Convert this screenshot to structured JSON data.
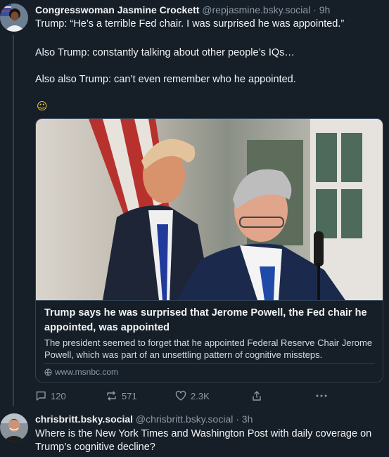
{
  "post1": {
    "author_name": "Congresswoman Jasmine Crockett",
    "author_handle": "@repjasmine.bsky.social",
    "separator": "·",
    "time": "9h",
    "paragraphs": [
      "Trump: “He’s a terrible Fed chair. I was surprised he was appointed.”",
      "Also Trump: constantly talking about other people’s IQs…",
      "Also also Trump: can’t even remember who he appointed."
    ],
    "emoji": "☺",
    "card": {
      "title": "Trump says he was surprised that Jerome Powell, the Fed chair he appointed, was appointed",
      "description": "The president seemed to forget that he appointed Federal Reserve Chair Jerome Powell, which was part of an unsettling pattern of cognitive missteps.",
      "domain": "www.msnbc.com",
      "domain_icon": "globe-icon"
    },
    "actions": {
      "reply_count": "120",
      "repost_count": "571",
      "like_count": "2.3K",
      "share_icon": "share-icon",
      "more_icon": "more-icon"
    }
  },
  "post2": {
    "author_name": "chrisbritt.bsky.social",
    "author_handle": "@chrisbritt.bsky.social",
    "separator": "·",
    "time": "3h",
    "text": "Where is the New York Times and Washington Post with daily coverage on Trump’s cognitive decline?"
  },
  "colors": {
    "background": "#161e27",
    "border": "#2e4052",
    "muted_text": "#8c9aa8",
    "primary_text": "#f1f3f5"
  }
}
